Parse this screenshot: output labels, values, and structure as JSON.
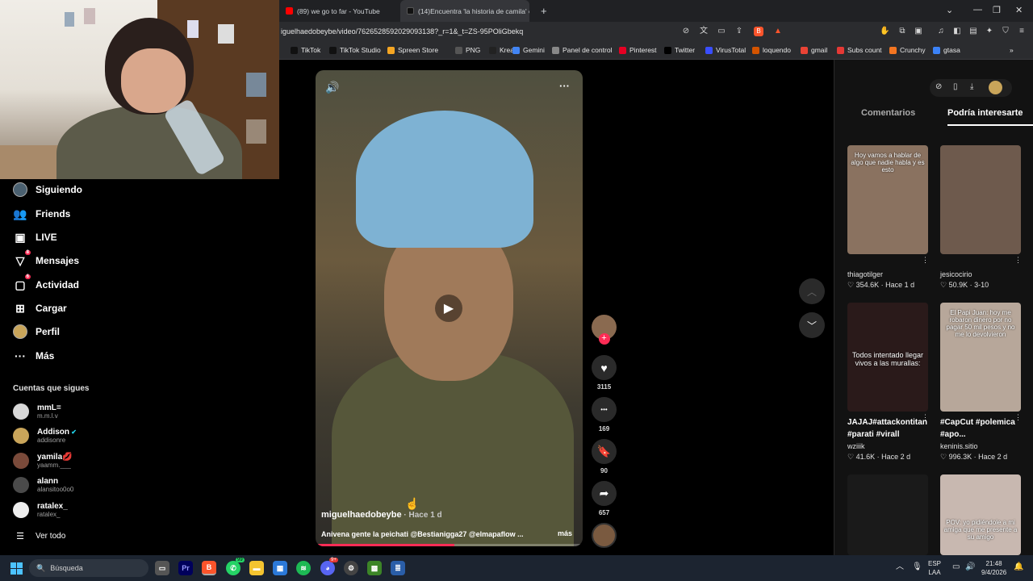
{
  "browser": {
    "tabs": [
      {
        "title": "(89) we go to far - YouTube",
        "color": "#ff0000"
      },
      {
        "title": "(14)Encuentra 'la historia de camila' c",
        "color": "#111111"
      }
    ],
    "new_tab": "+",
    "url": "iguelhaedobeybe/video/7626528592029093138?_r=1&_t=ZS-95POliGbekq",
    "bookmarks": [
      {
        "label": "TikTok",
        "color": "#111"
      },
      {
        "label": "TikTok Studio",
        "color": "#111"
      },
      {
        "label": "Spreen Store",
        "color": "#f5a623"
      },
      {
        "label": "PNG",
        "color": "#555"
      },
      {
        "label": "Krea",
        "color": "#222"
      },
      {
        "label": "Gemini",
        "color": "#4285f4"
      },
      {
        "label": "Panel de control",
        "color": "#888"
      },
      {
        "label": "Pinterest",
        "color": "#e60023"
      },
      {
        "label": "Twitter",
        "color": "#000"
      },
      {
        "label": "VirusTotal",
        "color": "#394eff"
      },
      {
        "label": "loquendo",
        "color": "#d35400"
      },
      {
        "label": "gmail",
        "color": "#ea4335"
      },
      {
        "label": "Subs count",
        "color": "#e53935"
      },
      {
        "label": "Crunchy",
        "color": "#f47521"
      },
      {
        "label": "gtasa",
        "color": "#3b82f6"
      }
    ]
  },
  "sidebar": {
    "nav": [
      {
        "label": "Siguiendo",
        "icon": "following-avatar-icon"
      },
      {
        "label": "Friends",
        "icon": "friends-icon"
      },
      {
        "label": "LIVE",
        "icon": "live-icon"
      },
      {
        "label": "Mensajes",
        "icon": "messages-icon",
        "badge": "8"
      },
      {
        "label": "Actividad",
        "icon": "activity-icon",
        "badge": "6"
      },
      {
        "label": "Cargar",
        "icon": "upload-icon"
      },
      {
        "label": "Perfil",
        "icon": "profile-avatar-icon"
      },
      {
        "label": "Más",
        "icon": "more-icon"
      }
    ],
    "following_title": "Cuentas que sigues",
    "accounts": [
      {
        "name": "mmL=",
        "handle": "m.m.l.v",
        "color": "#d8d8d8"
      },
      {
        "name": "Addison",
        "handle": "addisonre",
        "color": "#c9a55a",
        "verified": true
      },
      {
        "name": "yamila💋",
        "handle": "yaamm.___",
        "color": "#7a4a3a"
      },
      {
        "name": "alann",
        "handle": "alansitoo0o0",
        "color": "#4a4a4a"
      },
      {
        "name": "ratalex_",
        "handle": "ratalex_",
        "color": "#eeeeee"
      }
    ],
    "see_all": "Ver todo"
  },
  "video": {
    "author": "miguelhaedobeybe",
    "time": " · Hace 1 d",
    "caption": "Anivena gente la peichati @Bestianigga27 @elmapaflow ...",
    "more": "más",
    "progress": 0.52
  },
  "actions": [
    {
      "name": "like",
      "icon": "♥",
      "count": "3115"
    },
    {
      "name": "comment",
      "icon": "•••",
      "count": "169"
    },
    {
      "name": "save",
      "icon": "🔖",
      "count": "90"
    },
    {
      "name": "share",
      "icon": "➦",
      "count": "657"
    }
  ],
  "right_panel": {
    "tabs": [
      "Comentarios",
      "Podría interesarte"
    ],
    "cards": [
      {
        "title": "",
        "user": "thiagotilger",
        "likes": "354.6K",
        "date": "Hace 1 d",
        "bg": "#8a7260",
        "text": "Hoy vamos a hablar de algo que nadie habla y es esto"
      },
      {
        "title": "",
        "user": "jesicocirio",
        "likes": "50.9K",
        "date": "3-10",
        "bg": "#6e5a4d",
        "text": ""
      },
      {
        "title": "JAJAJ#attackontitan #parati #virall",
        "user": "wziiik",
        "likes": "41.6K",
        "date": "Hace 2 d",
        "bg": "#2a1a1a",
        "text": "Todos intentado llegar vivos a las murallas:"
      },
      {
        "title": "#CapCut #polemica #apo...",
        "user": "keninis.sitio",
        "likes": "996.3K",
        "date": "Hace 2 d",
        "bg": "#b7a79a",
        "text": "El Papi Juan: hoy me robaron dinero por no pagar 50 mil pesos y no me lo devolvieron"
      },
      {
        "title": "",
        "user": "",
        "likes": "",
        "date": "",
        "bg": "#1a1a1a",
        "text": ""
      },
      {
        "title": "",
        "user": "",
        "likes": "",
        "date": "",
        "bg": "#c8b8b0",
        "text": "POV: yo pidiéndole a mi amiga que me presente a su amigo"
      }
    ]
  },
  "taskbar": {
    "search": "Búsqueda",
    "lang": "ESP",
    "lang2": "LAA",
    "time": "21:48",
    "date": "9/4/2026",
    "badges": {
      "whatsapp": "99",
      "discord": "9+"
    }
  }
}
